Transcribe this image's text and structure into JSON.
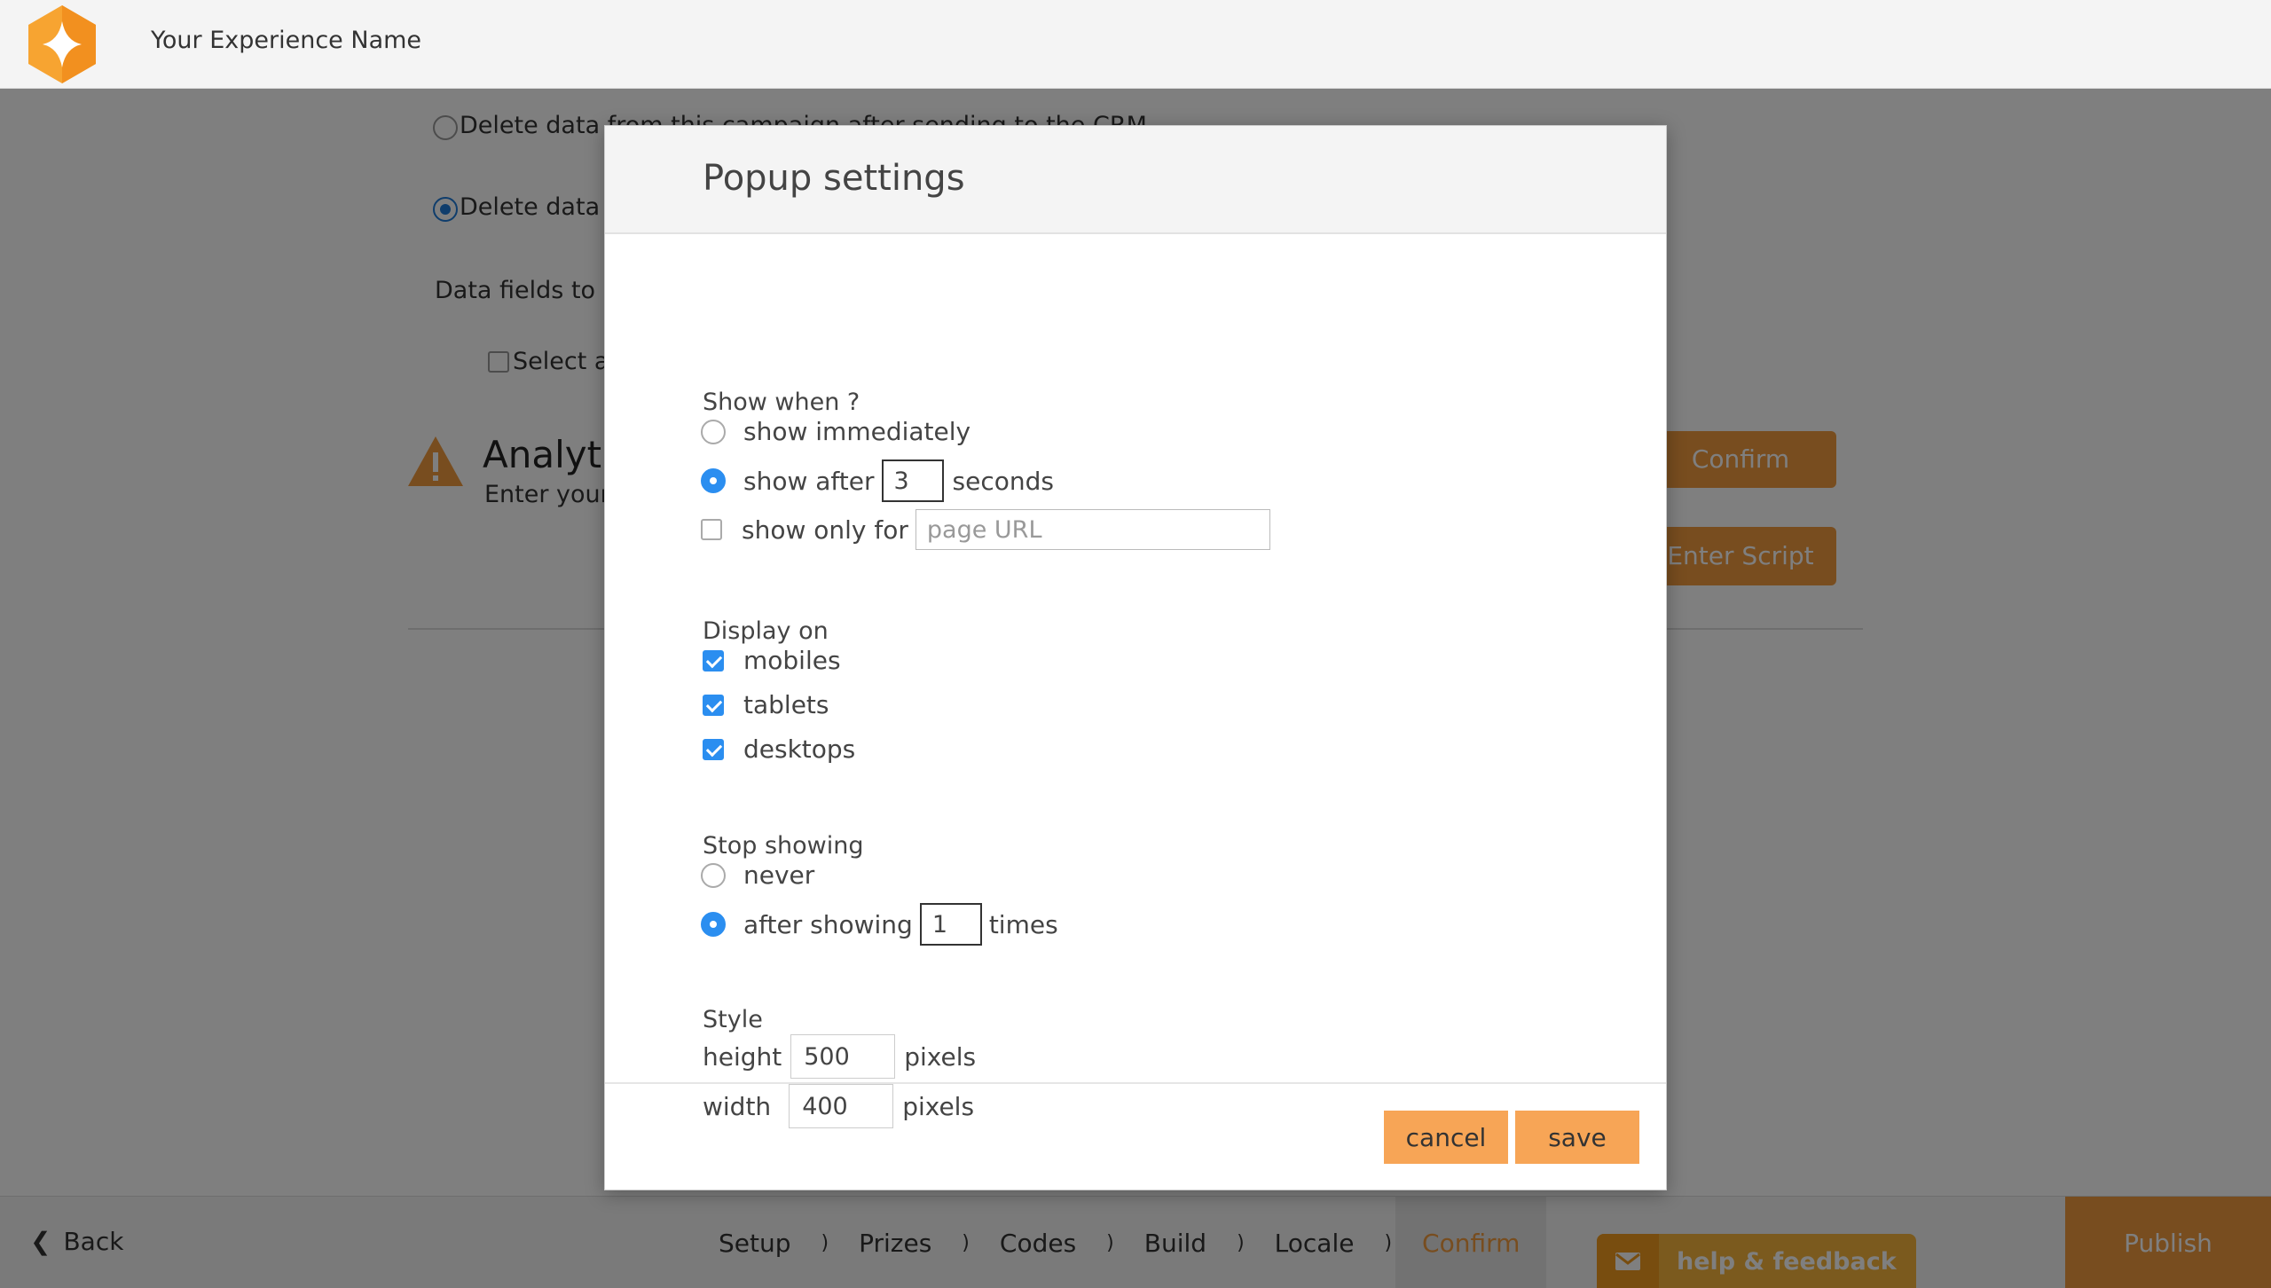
{
  "header": {
    "experience_name": "Your Experience Name",
    "logo_icon": "sparkle-hexagon-logo"
  },
  "background": {
    "delete_option_1": "Delete data from this campaign after sending to the CRM",
    "delete_option_2": "Delete data f",
    "data_fields_label": "Data fields to d",
    "select_all_label": "Select a",
    "confirm_label": "Confirm",
    "analytics_title": "Analytic",
    "analytics_sub": "Enter your",
    "enter_script_label": "Enter Script"
  },
  "modal": {
    "title": "Popup settings",
    "show_when": {
      "title": "Show when ?",
      "immediately": "show immediately",
      "after_prefix": "show after",
      "after_value": "3",
      "after_suffix": "seconds",
      "only_for": "show only for",
      "url_placeholder": "page URL"
    },
    "display_on": {
      "title": "Display on",
      "mobiles": "mobiles",
      "tablets": "tablets",
      "desktops": "desktops"
    },
    "stop_showing": {
      "title": "Stop showing",
      "never": "never",
      "after_prefix": "after showing",
      "after_value": "1",
      "after_suffix": "times"
    },
    "style": {
      "title": "Style",
      "height_label": "height",
      "height_value": "500",
      "width_label": "width",
      "width_value": "400",
      "unit": "pixels"
    },
    "cancel_label": "cancel",
    "save_label": "save"
  },
  "bottombar": {
    "back_label": "Back",
    "steps": [
      "Setup",
      "Prizes",
      "Codes",
      "Build",
      "Locale",
      "Confirm"
    ],
    "active_step": "Confirm",
    "separator": ")",
    "help_label": "help & feedback",
    "publish_label": "Publish"
  },
  "colors": {
    "accent": "#f09a3e",
    "radio_checked": "#2b8ef0",
    "help_bg": "#f7b53c"
  }
}
